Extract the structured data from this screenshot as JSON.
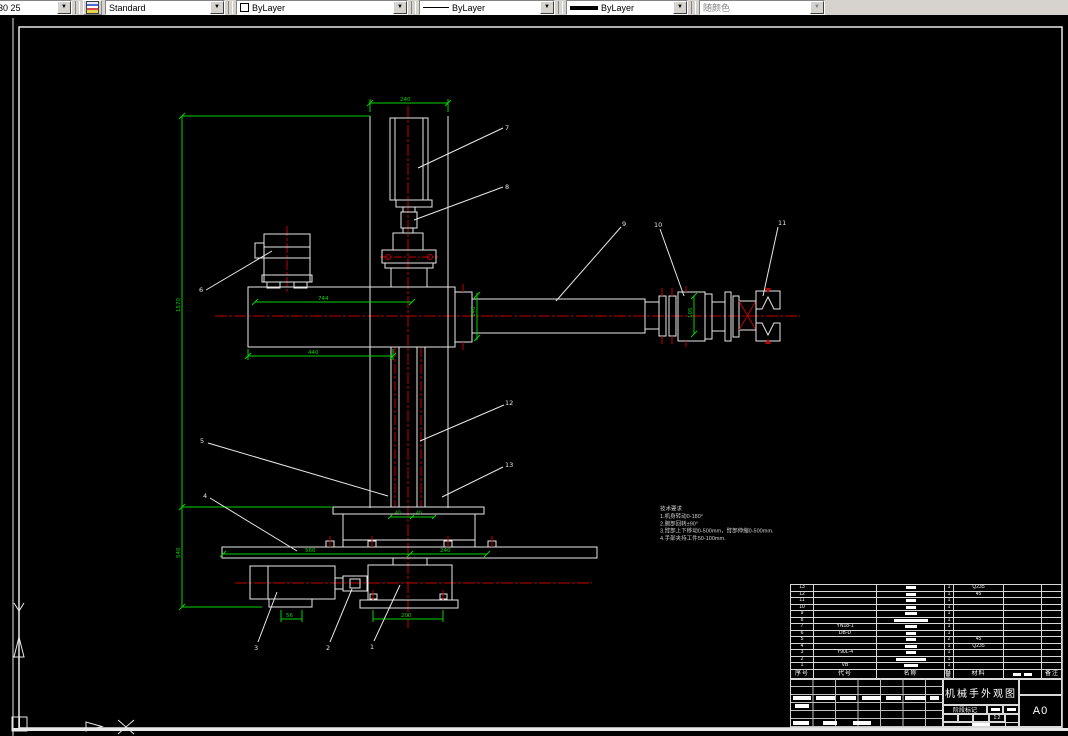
{
  "toolbar": {
    "partial_combo": "30 25",
    "text_style": "Standard",
    "color": "ByLayer",
    "linetype": "ByLayer",
    "lineweight": "ByLayer",
    "plot_style": "随颜色"
  },
  "icons": {
    "dropdown_arrow": "▼"
  },
  "colors": {
    "dim_green": "#00d400",
    "centerline_red": "#c00000",
    "geometry_white": "#e8e8e8",
    "toolbar_bg": "#d6d3ce"
  },
  "notes": {
    "title": "技术要求",
    "line1": "1.机身转动0-180°",
    "line2": "2.腕部回转±90°",
    "line3": "3.臂部上下移动0-500mm，臂部伸缩0-500mm.",
    "line4": "4.手部夹持工件50-100mm."
  },
  "drawing": {
    "balloons": [
      "1",
      "2",
      "3",
      "4",
      "5",
      "6",
      "7",
      "8",
      "9",
      "10",
      "11",
      "12",
      "13"
    ],
    "dims": {
      "cyl_width": "240",
      "arm_top": "744",
      "arm_bottom": "440",
      "arm_height": "140",
      "wrist": "105",
      "total_height": "1570",
      "base_height": "540",
      "col_left": "40",
      "col_right": "40",
      "plate_left": "560",
      "plate_right": "240",
      "motor_foot": "56",
      "gear_base": "200"
    }
  },
  "parts_table": {
    "headers": [
      "序号",
      "代号",
      "名称",
      "数量",
      "材料",
      "备注"
    ],
    "rows": [
      {
        "no": "13",
        "code": "",
        "qty": "1",
        "mat": "Q235",
        "name_w": 10
      },
      {
        "no": "12",
        "code": "",
        "qty": "1",
        "mat": "45",
        "name_w": 10
      },
      {
        "no": "11",
        "code": "",
        "qty": "1",
        "mat": "",
        "name_w": 10
      },
      {
        "no": "10",
        "code": "",
        "qty": "1",
        "mat": "",
        "name_w": 10
      },
      {
        "no": "9",
        "code": "",
        "qty": "1",
        "mat": "",
        "name_w": 12
      },
      {
        "no": "8",
        "code": "",
        "qty": "1",
        "mat": "",
        "name_w": 34
      },
      {
        "no": "7",
        "code": "YN18-1",
        "qty": "1",
        "mat": "",
        "name_w": 12
      },
      {
        "no": "6",
        "code": "DB-D",
        "qty": "1",
        "mat": "",
        "name_w": 10
      },
      {
        "no": "5",
        "code": "",
        "qty": "2",
        "mat": "45",
        "name_w": 10
      },
      {
        "no": "4",
        "code": "",
        "qty": "1",
        "mat": "Q235",
        "name_w": 12
      },
      {
        "no": "3",
        "code": "Y90L-4",
        "qty": "1",
        "mat": "",
        "name_w": 10
      },
      {
        "no": "2",
        "code": "",
        "qty": "1",
        "mat": "",
        "name_w": 30
      },
      {
        "no": "1",
        "code": "VB",
        "qty": "1",
        "mat": "",
        "name_w": 14
      }
    ]
  },
  "title_block": {
    "title": "机械手外观图",
    "stage_label": "阶段标记",
    "scale": "1:2",
    "sheet": "A0"
  }
}
